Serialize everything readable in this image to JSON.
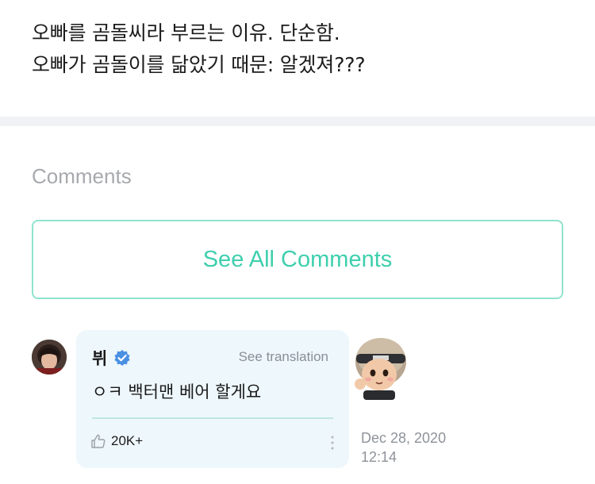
{
  "post": {
    "lines": [
      "오빠를 곰돌씨라 부르는 이유. 단순함.",
      "오빠가 곰돌이를 닮았기 때문: 알겠져???"
    ]
  },
  "comments": {
    "heading": "Comments",
    "see_all_label": "See All Comments",
    "items": [
      {
        "author": "뷔",
        "verified": true,
        "translate_label": "See translation",
        "text": "ㅇㅋ 백터맨 베어 할게요",
        "likes": "20K+",
        "date": "Dec 28, 2020",
        "time": "12:14"
      }
    ]
  },
  "colors": {
    "accent": "#3ecfae",
    "accent_border": "#8fe3cf",
    "bubble_bg": "#eef7fc",
    "verified": "#4a90e2",
    "muted_text": "#a7a9ad"
  },
  "icons": {
    "verified": "verified-check-icon",
    "like": "thumbs-up-icon",
    "more": "more-vertical-icon"
  }
}
